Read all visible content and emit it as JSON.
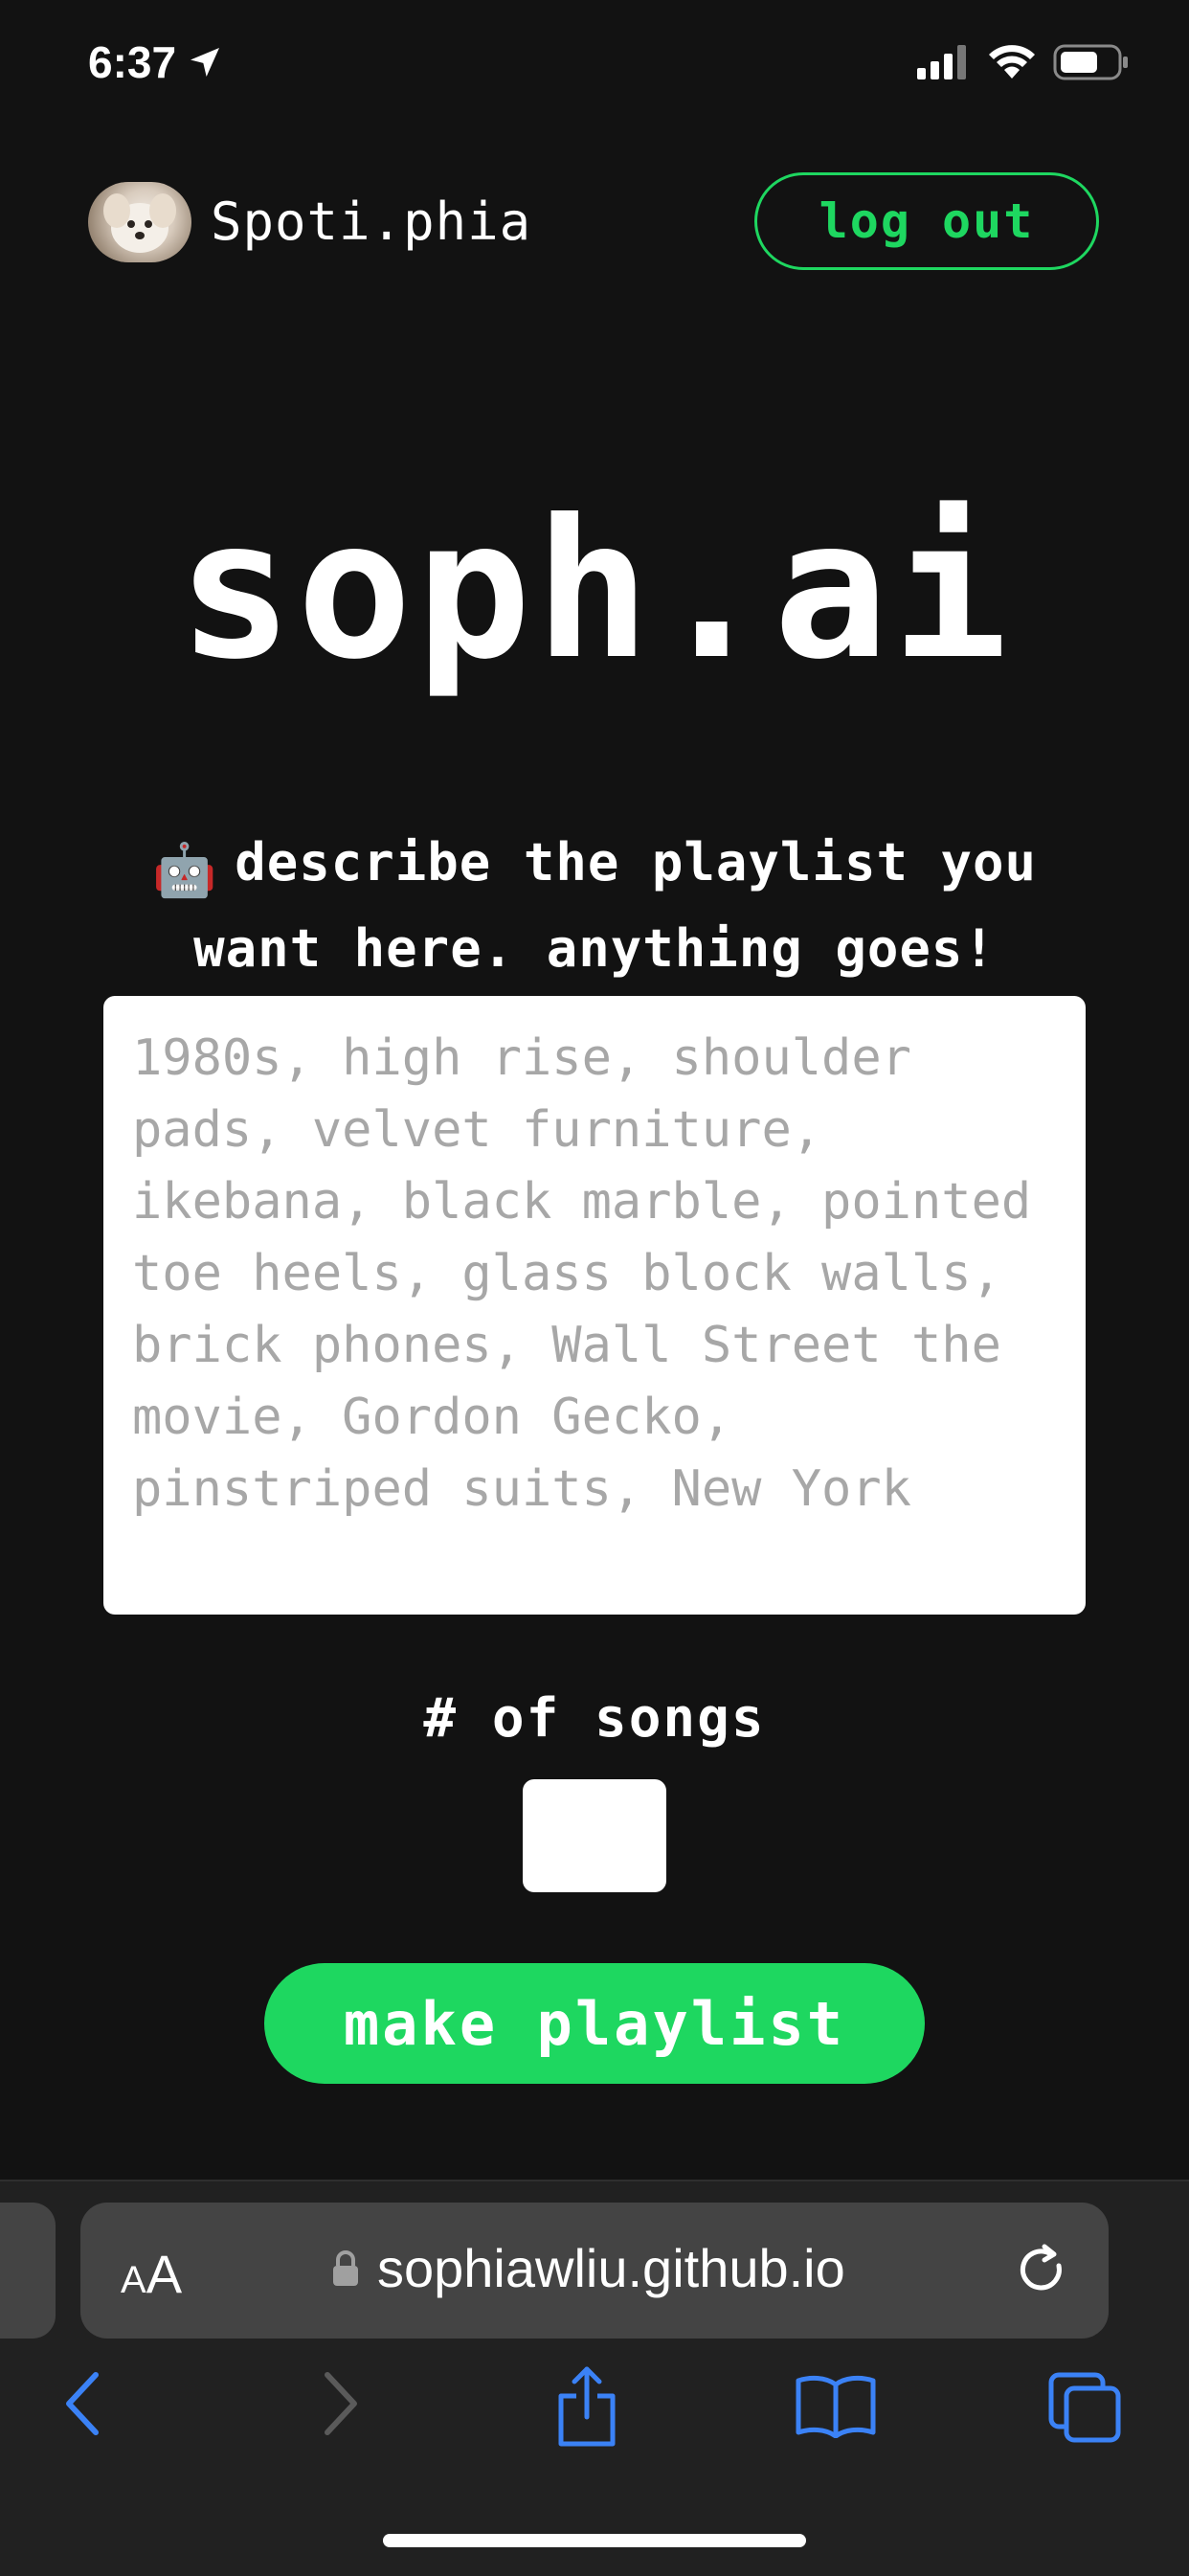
{
  "status_bar": {
    "time": "6:37",
    "icons": [
      "location-arrow-icon",
      "signal-icon",
      "wifi-icon",
      "battery-icon"
    ]
  },
  "header": {
    "brand": "Spoti.phia",
    "logout_label": "log out"
  },
  "main": {
    "title": "soph.ai",
    "prompt_emoji": "🤖",
    "prompt": "describe the playlist you want here. anything goes!",
    "description_placeholder": "1980s, high rise, shoulder pads, velvet furniture, ikebana, black marble, pointed toe heels, glass block walls, brick phones, Wall Street the movie, Gordon Gecko, pinstriped suits, New York",
    "songs_label": "# of songs",
    "songs_value": "",
    "make_button": "make playlist"
  },
  "browser": {
    "text_size_small": "A",
    "text_size_big": "A",
    "url": "sophiawliu.github.io"
  },
  "colors": {
    "background": "#121212",
    "accent": "#1ed760",
    "toolbar": "#212121",
    "link_blue": "#3b82f6"
  }
}
